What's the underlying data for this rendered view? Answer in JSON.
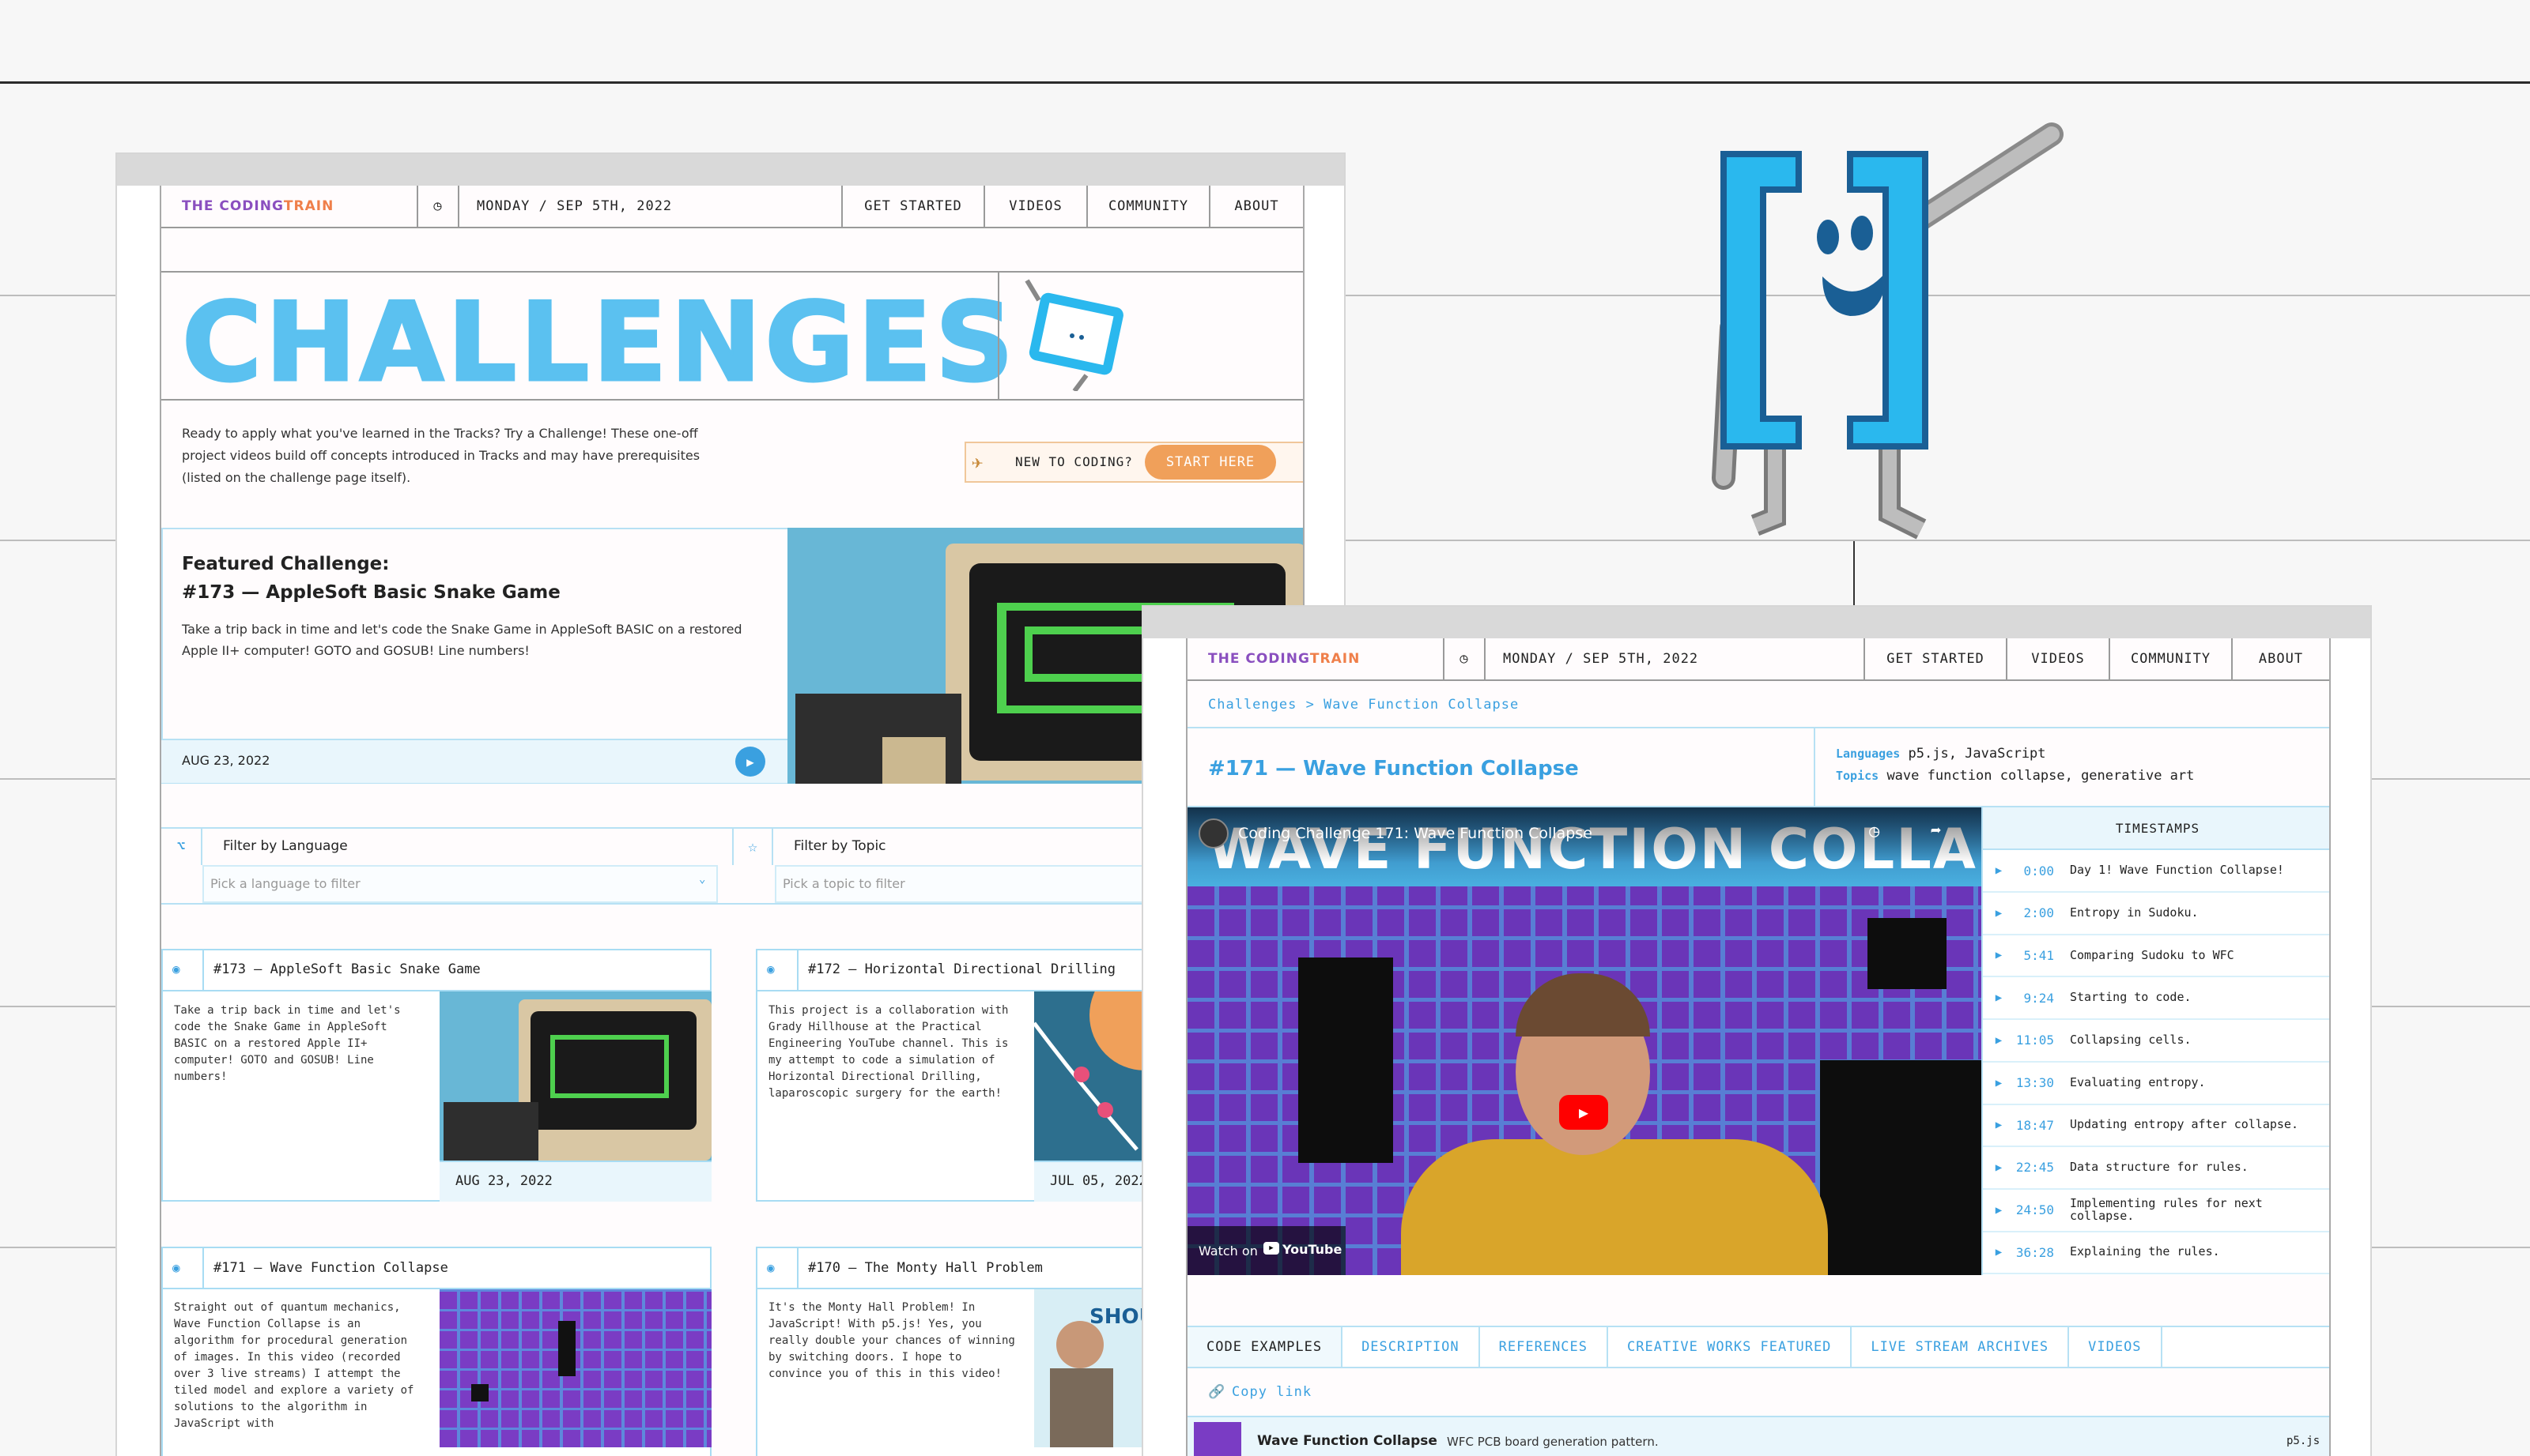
{
  "site": {
    "logo_part1": "THE CODING ",
    "logo_part2": "TRAIN",
    "date": "MONDAY / SEP 5TH, 2022"
  },
  "nav": [
    "GET STARTED",
    "VIDEOS",
    "COMMUNITY",
    "ABOUT"
  ],
  "challenges_page": {
    "title": "CHALLENGES",
    "intro": "Ready to apply what you've learned in the Tracks? Try a Challenge! These one-off project videos build off concepts introduced in Tracks and may have prerequisites (listed on the challenge page itself).",
    "new_to_coding": "NEW TO CODING?",
    "start_here": "START HERE",
    "featured_label": "Featured Challenge:",
    "featured_title": "#173 — AppleSoft Basic Snake Game",
    "featured_desc": "Take a trip back in time and let's code the Snake Game in AppleSoft BASIC on a restored Apple II+ computer! GOTO and GOSUB! Line numbers!",
    "featured_date": "AUG 23, 2022",
    "filter_language_label": "Filter by Language",
    "filter_language_placeholder": "Pick a language to filter",
    "filter_topic_label": "Filter by Topic",
    "filter_topic_placeholder": "Pick a topic to filter",
    "cards": [
      {
        "title": "#173 — AppleSoft Basic Snake Game",
        "desc": "Take a trip back in time and let's code the Snake Game in AppleSoft BASIC on a restored Apple II+ computer! GOTO and GOSUB! Line numbers!",
        "date": "AUG 23, 2022"
      },
      {
        "title": "#172 — Horizontal Directional Drilling",
        "desc": "This project is a collaboration with Grady Hillhouse at the Practical Engineering YouTube channel. This is my attempt to code a simulation of Horizontal Directional Drilling, laparoscopic surgery for the earth!",
        "date": "JUL 05, 2022"
      },
      {
        "title": "#171 — Wave Function Collapse",
        "desc": "Straight out of quantum mechanics, Wave Function Collapse is an algorithm for procedural generation of images. In this video (recorded over 3 live streams) I attempt the tiled model and explore a variety of solutions to the algorithm in JavaScript with",
        "date": ""
      },
      {
        "title": "#170 — The Monty Hall Problem",
        "desc": "It's the Monty Hall Problem! In JavaScript! With p5.js! Yes, you really double your chances of winning by switching doors. I hope to convince you of this in this video!",
        "date": ""
      }
    ]
  },
  "detail_page": {
    "breadcrumb": "Challenges > Wave Function Collapse",
    "title": "#171 — Wave Function Collapse",
    "languages_label": "Languages",
    "languages": "p5.js, JavaScript",
    "topics_label": "Topics",
    "topics": "wave function collapse, generative art",
    "video_title": "Coding Challenge 171: Wave Function Collapse",
    "video_banner": "WAVE FUNCTION COLLAPSE",
    "watch_on": "Watch on",
    "youtube": "YouTube",
    "timestamps_header": "TIMESTAMPS",
    "timestamps": [
      {
        "time": "0:00",
        "label": "Day 1! Wave Function Collapse!"
      },
      {
        "time": "2:00",
        "label": "Entropy in Sudoku."
      },
      {
        "time": "5:41",
        "label": "Comparing Sudoku to WFC"
      },
      {
        "time": "9:24",
        "label": "Starting to code."
      },
      {
        "time": "11:05",
        "label": "Collapsing cells."
      },
      {
        "time": "13:30",
        "label": "Evaluating entropy."
      },
      {
        "time": "18:47",
        "label": "Updating entropy after collapse."
      },
      {
        "time": "22:45",
        "label": "Data structure for rules."
      },
      {
        "time": "24:50",
        "label": "Implementing rules for next collapse."
      },
      {
        "time": "36:28",
        "label": "Explaining the rules."
      }
    ],
    "tabs": [
      "CODE EXAMPLES",
      "DESCRIPTION",
      "REFERENCES",
      "CREATIVE WORKS FEATURED",
      "LIVE STREAM ARCHIVES",
      "VIDEOS"
    ],
    "copy_link": "Copy link",
    "example_title": "Wave Function Collapse",
    "example_desc": "WFC PCB board generation pattern.",
    "example_lang": "p5.js"
  }
}
